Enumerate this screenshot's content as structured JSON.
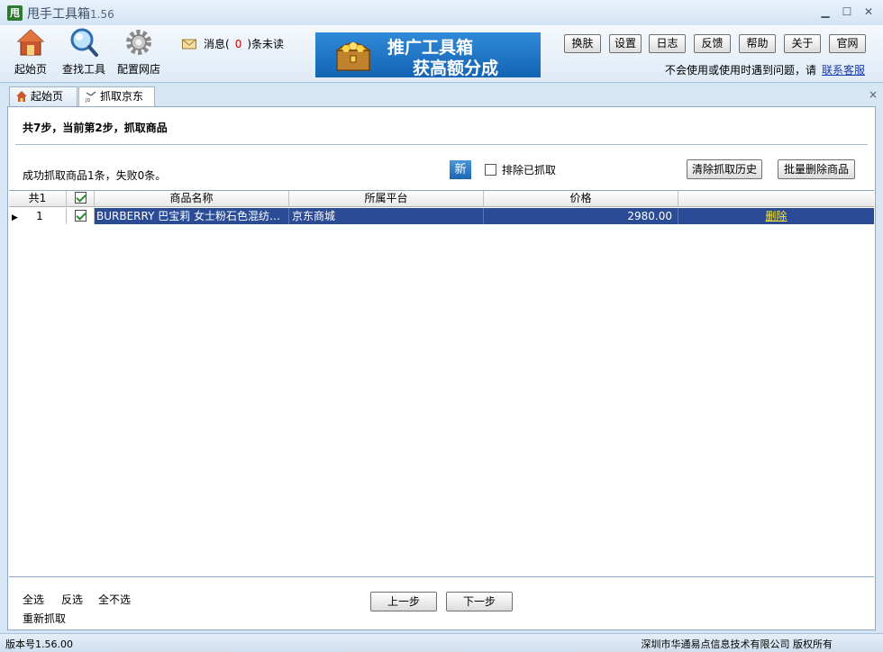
{
  "window": {
    "logo_char": "甩",
    "title": "甩手工具箱",
    "version": "1.56",
    "minimize": "▁",
    "maximize": "☐",
    "close": "✕"
  },
  "toolbar": {
    "tools": [
      {
        "label": "起始页",
        "icon": "home-icon"
      },
      {
        "label": "查找工具",
        "icon": "magnifier-icon"
      },
      {
        "label": "配置网店",
        "icon": "gear-icon"
      }
    ],
    "message": {
      "prefix": "消息(",
      "count": "0",
      "suffix": ")条未读"
    },
    "banner": {
      "line1": "推广工具箱",
      "line2": "获高额分成"
    },
    "buttons": [
      "换肤",
      "设置",
      "日志",
      "反馈",
      "帮助",
      "关于",
      "官网"
    ],
    "help_text": "不会使用或使用时遇到问题，请",
    "help_link": "联系客服"
  },
  "tabs": [
    {
      "label": "起始页",
      "icon": "home-icon",
      "active": false
    },
    {
      "label": "抓取京东",
      "icon": "jd-icon",
      "active": true
    }
  ],
  "tab_close": "×",
  "content": {
    "step_header": "共7步，当前第2步，抓取商品",
    "result": "成功抓取商品1条，失败0条。",
    "new_button": "新",
    "exclude_label": "排除已抓取",
    "clear_history": "清除抓取历史",
    "bulk_delete": "批量删除商品",
    "table": {
      "headers": [
        "共1",
        "",
        "商品名称",
        "所属平台",
        "价格",
        ""
      ],
      "rows": [
        {
          "index": "1",
          "name": "BURBERRY 巴宝莉 女士粉石色混纺…",
          "platform": "京东商城",
          "price": "2980.00",
          "action": "删除"
        }
      ]
    },
    "select_all": "全选",
    "invert": "反选",
    "select_none": "全不选",
    "refetch": "重新抓取",
    "prev": "上一步",
    "next": "下一步"
  },
  "status": {
    "version": "版本号1.56.00",
    "copyright": "深圳市华通易点信息技术有限公司 版权所有"
  }
}
